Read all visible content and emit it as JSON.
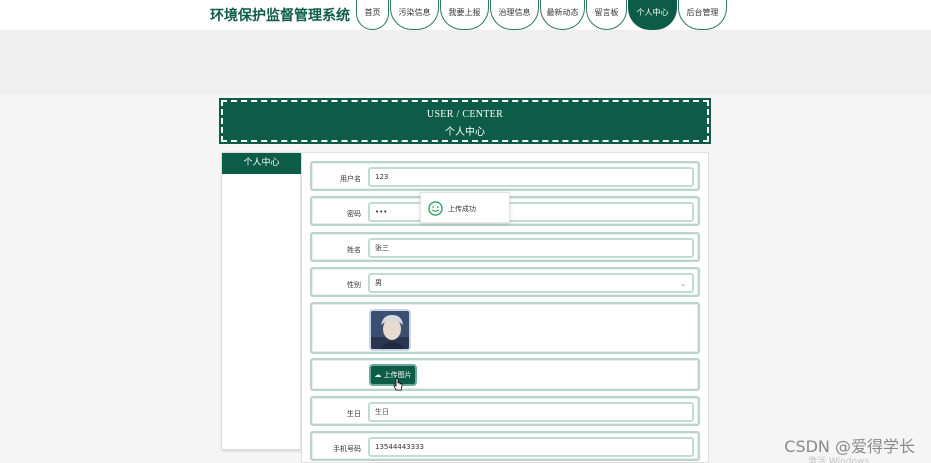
{
  "header": {
    "site_title": "环境保护监督管理系统",
    "nav": [
      {
        "label": "首页",
        "active": false
      },
      {
        "label": "污染信息",
        "active": false
      },
      {
        "label": "我要上报",
        "active": false
      },
      {
        "label": "治理信息",
        "active": false
      },
      {
        "label": "最新动态",
        "active": false
      },
      {
        "label": "留言板",
        "active": false
      },
      {
        "label": "个人中心",
        "active": true
      },
      {
        "label": "后台管理",
        "active": false
      }
    ]
  },
  "center": {
    "title_en": "USER / CENTER",
    "title_zh": "个人中心"
  },
  "sidebar": {
    "tab_label": "个人中心"
  },
  "form": {
    "username": {
      "label": "用户名",
      "value": "123"
    },
    "password": {
      "label": "密码",
      "value": "•••"
    },
    "name": {
      "label": "姓名",
      "value": "张三"
    },
    "gender": {
      "label": "性别",
      "value": "男"
    },
    "upload_button": "上传图片",
    "birthday": {
      "label": "生日",
      "placeholder": "生日"
    },
    "phone": {
      "label": "手机号码",
      "value": "13544443333"
    }
  },
  "toast": {
    "message": "上传成功",
    "icon": "smile-icon"
  },
  "watermark": {
    "text": "CSDN @爱得学长",
    "activation": "激活 Windows"
  },
  "colors": {
    "brand": "#0d5c48",
    "border": "#b9d5cb"
  }
}
